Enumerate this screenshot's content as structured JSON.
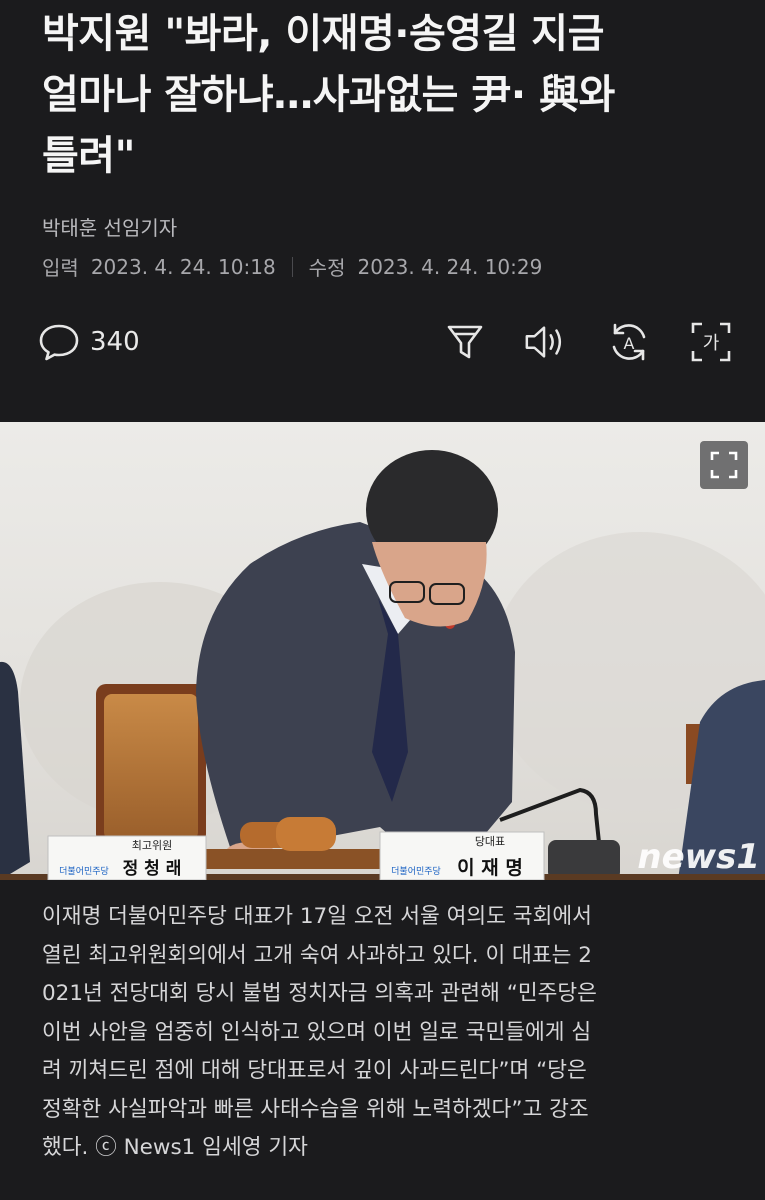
{
  "article": {
    "headline_lines": [
      "박지원 \"봐라, 이재명·송영길 지금",
      "얼마나 잘하냐…사과없는 尹· 與와",
      "틀려\""
    ],
    "reporter": "박태훈 선임기자",
    "input_label": "입력",
    "input_date": "2023. 4. 24. 10:18",
    "modified_label": "수정",
    "modified_date": "2023. 4. 24. 10:29"
  },
  "toolbar": {
    "comment_count": "340",
    "icons": [
      "comment-icon",
      "filter-icon",
      "speaker-icon",
      "translate-icon",
      "font-size-icon"
    ],
    "font_size_glyph": "가",
    "translate_glyph": "A"
  },
  "photo": {
    "nameplate_left_title": "최고위원",
    "nameplate_left_name": "정 청 래",
    "nameplate_center_title": "당대표",
    "nameplate_center_name": "이 재 명",
    "party_logo_text": "더불어민주당",
    "watermark": "news1",
    "expand_icon": "expand-icon"
  },
  "caption": {
    "lines": [
      "이재명 더불어민주당 대표가 17일 오전 서울 여의도 국회에서",
      "열린 최고위원회의에서 고개 숙여 사과하고 있다. 이 대표는 2",
      "021년 전당대회 당시 불법 정치자금 의혹과 관련해 “민주당은",
      "이번 사안을 엄중히 인식하고 있으며 이번 일로 국민들에게 심",
      "려 끼쳐드린 점에 대해 당대표로서 깊이 사과드린다”며 “당은",
      "정확한 사실파악과 빠른 사태수습을 위해 노력하겠다”고 강조",
      "했다. ⓒ News1 임세영 기자"
    ]
  },
  "colors": {
    "background": "#1b1b1d",
    "text": "#f2f2f2",
    "muted": "#a7a7ab",
    "party_blue": "#1c63c4"
  }
}
